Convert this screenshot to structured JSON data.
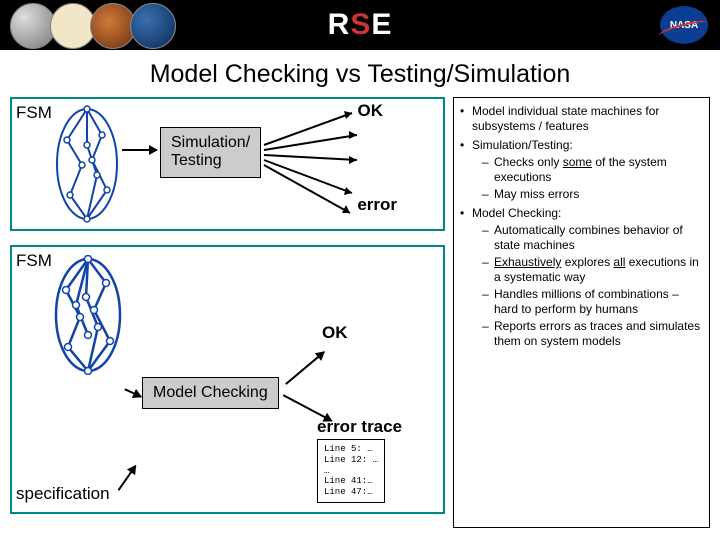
{
  "banner": {
    "logo_text": "R E",
    "logo_s": "S",
    "nasa": "NASA"
  },
  "title": "Model Checking vs Testing/Simulation",
  "panel1": {
    "fsm": "FSM",
    "process": "Simulation/\nTesting",
    "ok": "OK",
    "error": "error"
  },
  "panel2": {
    "fsm": "FSM",
    "spec": "specification",
    "process": "Model Checking",
    "ok": "OK",
    "error": "error trace",
    "trace": "Line 5: …\nLine 12: …\n…\nLine 41:…\nLine 47:…"
  },
  "bullets": {
    "b1": "Model individual state machines for subsystems / features",
    "b2": "Simulation/Testing:",
    "b2_d1_pre": "Checks only ",
    "b2_d1_u": "some",
    "b2_d1_post": " of the system executions",
    "b2_d2": "May miss errors",
    "b3": "Model Checking:",
    "b3_d1": "Automatically combines behavior of state machines",
    "b3_d2_u": "Exhaustively",
    "b3_d2_mid": " explores ",
    "b3_d2_u2": "all",
    "b3_d2_post": " executions in a systematic way",
    "b3_d3": "Handles millions of combinations – hard to perform by humans",
    "b3_d4": "Reports errors as traces and simulates them on system models"
  }
}
